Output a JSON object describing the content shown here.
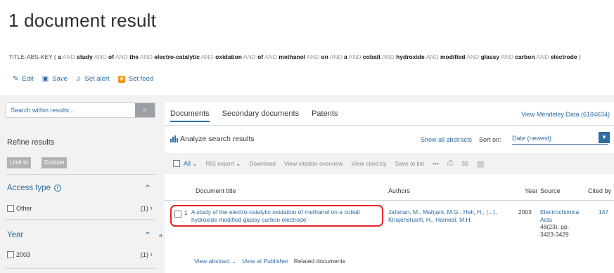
{
  "header": {
    "title": "1 document result"
  },
  "query": {
    "prefix": "TITLE-ABS-KEY (",
    "terms": [
      {
        "op": "",
        "kw": "a"
      },
      {
        "op": "AND",
        "kw": "study"
      },
      {
        "op": "AND",
        "kw": "of"
      },
      {
        "op": "AND",
        "kw": "the"
      },
      {
        "op": "AND",
        "kw": "electro-catalytic"
      },
      {
        "op": "AND",
        "kw": "oxidation"
      },
      {
        "op": "AND",
        "kw": "of"
      },
      {
        "op": "AND",
        "kw": "methanol"
      },
      {
        "op": "AND",
        "kw": "on"
      },
      {
        "op": "AND",
        "kw": "a"
      },
      {
        "op": "AND",
        "kw": "cobalt"
      },
      {
        "op": "AND",
        "kw": "hydroxide"
      },
      {
        "op": "AND",
        "kw": "modified"
      },
      {
        "op": "AND",
        "kw": "glassy"
      },
      {
        "op": "AND",
        "kw": "carbon"
      },
      {
        "op": "AND",
        "kw": "electrode"
      }
    ],
    "suffix": ")"
  },
  "actions": {
    "edit": "Edit",
    "save": "Save",
    "set_alert": "Set alert",
    "set_feed": "Set feed"
  },
  "left": {
    "search_placeholder": "Search within results...",
    "refine": "Refine results",
    "limit_to": "Limit to",
    "exclude": "Exclude",
    "access_type": {
      "heading": "Access type",
      "items": [
        {
          "label": "Other",
          "count": "(1)"
        }
      ]
    },
    "year": {
      "heading": "Year",
      "items": [
        {
          "label": "2003",
          "count": "(1)"
        }
      ]
    }
  },
  "tabs": [
    "Documents",
    "Secondary documents",
    "Patents"
  ],
  "mendeley": "View Mendeley Data (6184634)",
  "analyze": "Analyze search results",
  "show_all_abstracts": "Show all abstracts",
  "sort": {
    "label": "Sort on:",
    "value": "Date (newest)"
  },
  "toolbar": {
    "all": "All",
    "ris_export": "RIS export",
    "download": "Download",
    "view_citation_overview": "View citation overview",
    "view_cited_by": "View cited by",
    "save_to_list": "Save to list",
    "more": "•••"
  },
  "table": {
    "headers": {
      "title": "Document title",
      "authors": "Authors",
      "year": "Year",
      "source": "Source",
      "cited_by": "Cited by"
    },
    "rows": [
      {
        "num": "1",
        "title": "A study of the electro-catalytic oxidation of methanol on a cobalt hydroxide modified glassy carbon electrode",
        "authors": "Jafarian, M., Mahjani, M.G., Heli, H., (...), Khajehsharifi, H., Hamedi, M.H.",
        "year": "2003",
        "source_name": "Electrochimica Acta",
        "source_detail": "48(23), pp. 3423-3429",
        "cited_by": "147"
      }
    ]
  },
  "row_links": {
    "view_abstract": "View abstract",
    "view_at_publisher": "View at Publisher",
    "related_documents": "Related documents"
  },
  "colors": {
    "link": "#2e6ca4",
    "highlight": "#e0242a",
    "band": "#f2f2f2"
  }
}
